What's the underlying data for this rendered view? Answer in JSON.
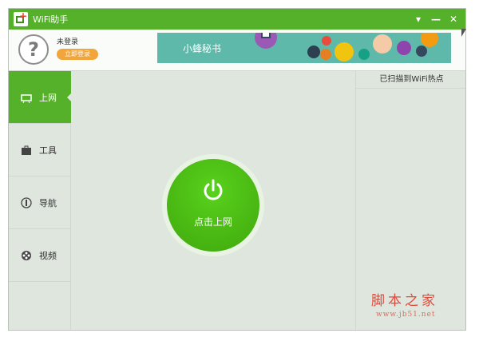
{
  "app": {
    "title": "WiFi助手"
  },
  "window_controls": {
    "menu": "▾",
    "minimize": "—",
    "close": "✕"
  },
  "header": {
    "login_status": "未登录",
    "login_button": "立即登录",
    "banner_text": "小蜂秘书"
  },
  "sidebar": {
    "items": [
      {
        "label": "上网",
        "icon": "wifi-router-icon"
      },
      {
        "label": "工具",
        "icon": "briefcase-icon"
      },
      {
        "label": "导航",
        "icon": "compass-icon"
      },
      {
        "label": "视频",
        "icon": "film-reel-icon"
      }
    ]
  },
  "main": {
    "connect_label": "点击上网"
  },
  "right_panel": {
    "header": "已扫描到WiFi热点"
  },
  "watermark": {
    "cn": "脚本之家",
    "url": "www.jb51.net"
  },
  "colors": {
    "accent": "#55b02a",
    "orange": "#f2a53a",
    "banner": "#5fb9aa",
    "background": "#dfe6de"
  }
}
